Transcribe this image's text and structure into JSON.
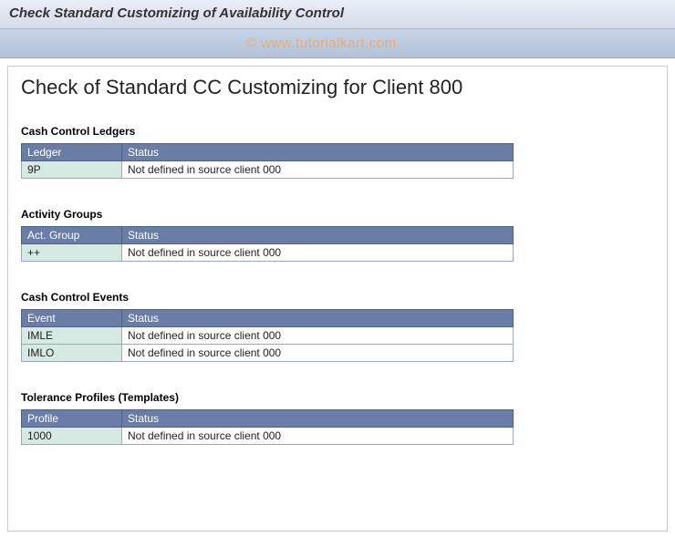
{
  "title_bar": "Check Standard Customizing of Availability Control",
  "watermark": "© www.tutorialkart.com",
  "page_heading": "Check of Standard CC Customizing for Client 800",
  "sections": {
    "ledgers": {
      "title": "Cash Control Ledgers",
      "col_key": "Ledger",
      "col_status": "Status",
      "rows": [
        {
          "key": "9P",
          "status": "Not defined in source client 000"
        }
      ]
    },
    "activity_groups": {
      "title": "Activity Groups",
      "col_key": "Act. Group",
      "col_status": "Status",
      "rows": [
        {
          "key": "++",
          "status": "Not defined in source client 000"
        }
      ]
    },
    "events": {
      "title": "Cash Control Events",
      "col_key": "Event",
      "col_status": "Status",
      "rows": [
        {
          "key": "IMLE",
          "status": "Not defined in source client 000"
        },
        {
          "key": "IMLO",
          "status": "Not defined in source client 000"
        }
      ]
    },
    "tolerance": {
      "title": "Tolerance Profiles (Templates)",
      "col_key": "Profile",
      "col_status": "Status",
      "rows": [
        {
          "key": "1000",
          "status": "Not defined in source client 000"
        }
      ]
    }
  }
}
